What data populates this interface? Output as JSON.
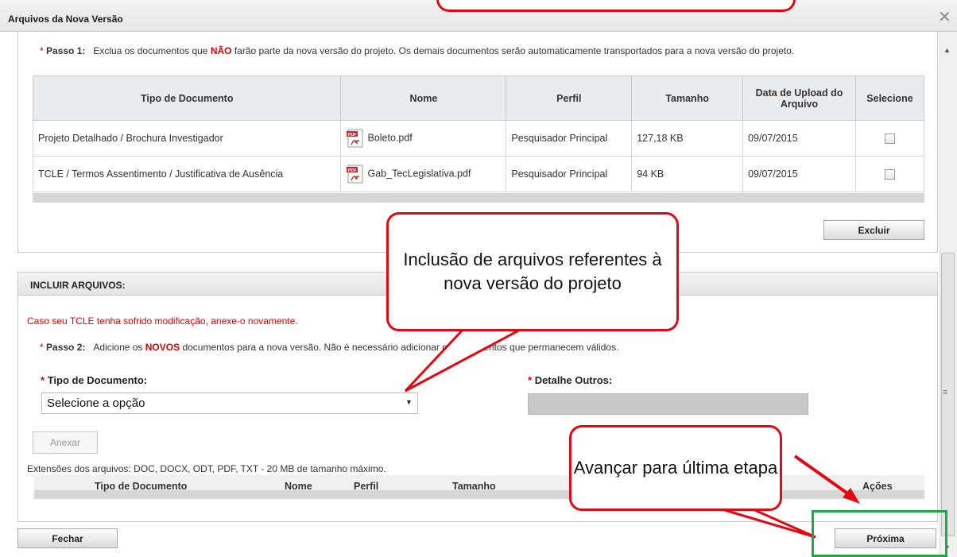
{
  "dialog": {
    "title": "Arquivos da Nova Versão",
    "close": "✕"
  },
  "step1": {
    "asterisk": "*",
    "label": "Passo 1:",
    "text_before": "Exclua os documentos que ",
    "emphasis": "NÃO",
    "text_after": " farão parte da nova versão do projeto. Os demais documentos serão automaticamente transportados para a nova versão do projeto."
  },
  "table": {
    "headers": [
      "Tipo de Documento",
      "Nome",
      "Perfil",
      "Tamanho",
      "Data de Upload do Arquivo",
      "Selecione"
    ],
    "rows": [
      {
        "tipo": "Projeto Detalhado / Brochura Investigador",
        "nome": "Boleto.pdf",
        "perfil": "Pesquisador Principal",
        "tamanho": "127,18 KB",
        "data": "09/07/2015",
        "icon": "pdf-icon"
      },
      {
        "tipo": "TCLE / Termos Assentimento / Justificativa de Ausência",
        "nome": "Gab_TecLegislativa.pdf",
        "perfil": "Pesquisador Principal",
        "tamanho": "94 KB",
        "data": "09/07/2015",
        "icon": "pdf-icon"
      }
    ]
  },
  "buttons": {
    "excluir": "Excluir",
    "anexar": "Anexar",
    "fechar": "Fechar",
    "proxima": "Próxima"
  },
  "include": {
    "title": "INCLUIR ARQUIVOS:",
    "warning": "Caso seu TCLE tenha sofrido modificação, anexe-o novamente.",
    "step2_label": "Passo 2:",
    "step2_before": "Adicione os ",
    "step2_emphasis": "NOVOS",
    "step2_after": " documentos para a nova versão. Não é necessário adicionar os documentos que permanecem válidos.",
    "tipo_label": "Tipo de Documento:",
    "tipo_value": "Selecione a opção",
    "detalhe_label": "Detalhe Outros:",
    "extensions": "Extensões dos arquivos: DOC, DOCX, ODT, PDF, TXT - 20 MB de tamanho máximo.",
    "attach_headers": {
      "tipo": "Tipo de Documento",
      "nome": "Nome",
      "perfil": "Perfil",
      "tamanho": "Tamanho",
      "acoes": "Ações"
    }
  },
  "callouts": {
    "inclusao": "Inclusão de arquivos referentes à nova versão do projeto",
    "avancar": "Avançar para última etapa"
  },
  "colors": {
    "annotation_red": "#e30613",
    "highlight_green": "#1ea84a",
    "warning_red": "#e00000"
  }
}
